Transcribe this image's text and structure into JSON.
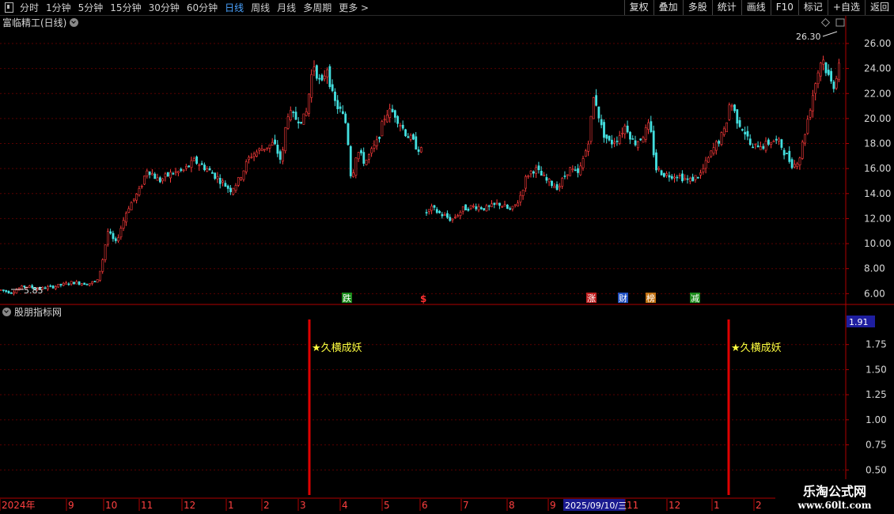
{
  "toolbar": {
    "left_items": [
      "分时",
      "1分钟",
      "5分钟",
      "15分钟",
      "30分钟",
      "60分钟",
      "日线",
      "周线",
      "月线",
      "多周期",
      "更多 >"
    ],
    "active_item": "日线",
    "right_buttons": [
      "复权",
      "叠加",
      "多股",
      "统计",
      "画线",
      "F10",
      "标记",
      "+自选",
      "返回"
    ]
  },
  "main_panel": {
    "title": "富临精工(日线)"
  },
  "indicator_panel": {
    "title": "股朋指标网",
    "current_value": "1.91",
    "value_badge_color": "#1e1ea0"
  },
  "colors": {
    "up": "#ff3b3b",
    "down": "#44e0e0",
    "grid": "#5a0000",
    "axis": "#b00000",
    "signal_bar": "#e00000",
    "signal_text": "#ffff40"
  },
  "chart_data": [
    {
      "type": "candlestick",
      "title": "富临精工(日线)",
      "y_ticks": [
        "26.00",
        "24.00",
        "22.00",
        "20.00",
        "18.00",
        "16.00",
        "14.00",
        "12.00",
        "10.00",
        "8.00",
        "6.00"
      ],
      "ylim": [
        5.2,
        27.2
      ],
      "grid": true,
      "price_path": [
        [
          0,
          6.3
        ],
        [
          12,
          6.1
        ],
        [
          30,
          6.6
        ],
        [
          50,
          6.4
        ],
        [
          70,
          6.6
        ],
        [
          90,
          6.9
        ],
        [
          110,
          6.8
        ],
        [
          122,
          7.0
        ],
        [
          128,
          8.5
        ],
        [
          135,
          11.0
        ],
        [
          145,
          10.0
        ],
        [
          160,
          12.8
        ],
        [
          175,
          14.2
        ],
        [
          185,
          16.0
        ],
        [
          200,
          15.0
        ],
        [
          215,
          15.6
        ],
        [
          230,
          15.8
        ],
        [
          245,
          16.6
        ],
        [
          260,
          16.0
        ],
        [
          275,
          15.2
        ],
        [
          290,
          14.3
        ],
        [
          300,
          15.0
        ],
        [
          315,
          17.0
        ],
        [
          330,
          17.6
        ],
        [
          345,
          18.0
        ],
        [
          355,
          16.5
        ],
        [
          362,
          20.5
        ],
        [
          372,
          20.0
        ],
        [
          385,
          20.0
        ],
        [
          395,
          24.5
        ],
        [
          405,
          22.5
        ],
        [
          412,
          24.3
        ],
        [
          420,
          21.5
        ],
        [
          430,
          20.5
        ],
        [
          437,
          19.5
        ],
        [
          443,
          15.0
        ],
        [
          450,
          17.5
        ],
        [
          460,
          16.5
        ],
        [
          475,
          18.0
        ],
        [
          487,
          20.5
        ],
        [
          497,
          20.5
        ],
        [
          510,
          19.0
        ],
        [
          525,
          17.8
        ],
        [
          533,
          17.3
        ]
      ],
      "price_path_2": [
        [
          538,
          12.5
        ],
        [
          545,
          12.8
        ],
        [
          555,
          12.4
        ],
        [
          570,
          11.9
        ],
        [
          585,
          12.8
        ],
        [
          600,
          13.0
        ],
        [
          615,
          12.8
        ],
        [
          630,
          13.2
        ],
        [
          645,
          12.6
        ],
        [
          655,
          13.5
        ],
        [
          665,
          15.5
        ],
        [
          675,
          16.0
        ],
        [
          690,
          15.0
        ],
        [
          705,
          14.5
        ],
        [
          718,
          16.0
        ],
        [
          730,
          15.5
        ],
        [
          742,
          18.0
        ],
        [
          750,
          22.0
        ],
        [
          760,
          19.0
        ],
        [
          770,
          18.0
        ],
        [
          780,
          18.5
        ],
        [
          790,
          19.5
        ],
        [
          800,
          18.0
        ],
        [
          810,
          18.5
        ],
        [
          820,
          19.5
        ],
        [
          828,
          16.0
        ],
        [
          840,
          15.5
        ],
        [
          855,
          15.5
        ],
        [
          870,
          15.0
        ],
        [
          885,
          15.6
        ],
        [
          900,
          17.5
        ],
        [
          915,
          19.0
        ],
        [
          922,
          21.5
        ],
        [
          930,
          20.0
        ],
        [
          940,
          19.0
        ],
        [
          950,
          17.5
        ],
        [
          958,
          18.0
        ],
        [
          965,
          17.8
        ],
        [
          975,
          18.3
        ],
        [
          985,
          18.0
        ],
        [
          995,
          16.8
        ],
        [
          1002,
          16.2
        ],
        [
          1010,
          17.0
        ],
        [
          1020,
          20.0
        ],
        [
          1030,
          23.0
        ],
        [
          1038,
          25.0
        ],
        [
          1045,
          23.5
        ],
        [
          1052,
          22.5
        ],
        [
          1058,
          24.0
        ],
        [
          1062,
          25.5
        ]
      ],
      "annotations": {
        "high": "26.30",
        "low": "5.85"
      },
      "markers": [
        {
          "label": "跌",
          "kind": "green"
        },
        {
          "label": "$",
          "kind": "red-text"
        },
        {
          "label": "涨",
          "kind": "red"
        },
        {
          "label": "财",
          "kind": "blue"
        },
        {
          "label": "榜",
          "kind": "orange"
        },
        {
          "label": "减",
          "kind": "green"
        }
      ]
    },
    {
      "type": "bar",
      "title": "股朋指标网",
      "y_ticks": [
        "1.75",
        "1.50",
        "1.25",
        "1.00",
        "0.75",
        "0.50"
      ],
      "ylim": [
        0.25,
        2.0
      ],
      "signals": [
        {
          "label": "★久横成妖",
          "value": 2.0
        },
        {
          "label": "★久横成妖",
          "value": 2.0
        }
      ]
    }
  ],
  "date_axis": {
    "labels": [
      "2024年",
      "9",
      "10",
      "11",
      "12",
      "1",
      "2",
      "3",
      "4",
      "5",
      "6",
      "7",
      "8",
      "9",
      "11",
      "12",
      "1",
      "2"
    ],
    "cursor_date": "2025/09/10/三"
  },
  "watermark": {
    "brand": "乐淘公式网",
    "url": "www.60lt.com"
  }
}
